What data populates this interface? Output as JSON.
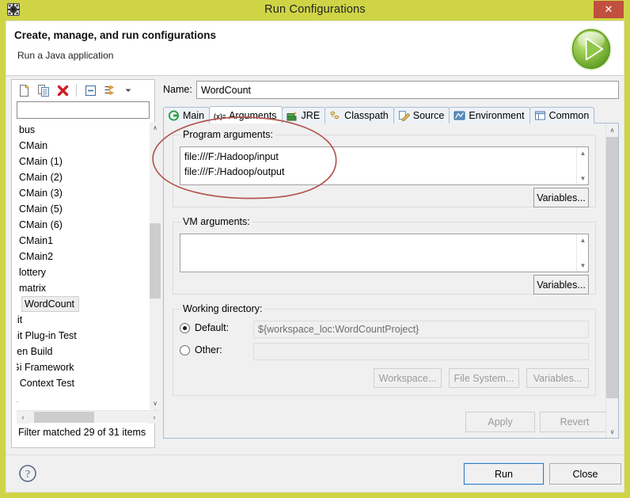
{
  "window": {
    "title": "Run Configurations",
    "app_icon": "gear-icon",
    "close_label": "✕"
  },
  "header": {
    "title": "Create, manage, and run configurations",
    "subtitle": "Run a Java application",
    "icon": "run-green-play-icon"
  },
  "tree_panel": {
    "toolbar": [
      {
        "name": "new-configuration-button",
        "tooltip": "New launch configuration"
      },
      {
        "name": "duplicate-configuration-button",
        "tooltip": "Duplicate"
      },
      {
        "name": "delete-configuration-button",
        "tooltip": "Delete"
      },
      {
        "name": "collapse-all-button",
        "tooltip": "Collapse All"
      },
      {
        "name": "filter-button",
        "tooltip": "Filter"
      },
      {
        "name": "filter-dropdown-arrow",
        "tooltip": "Filter menu"
      }
    ],
    "filter_input": {
      "value": "",
      "placeholder": ""
    },
    "items": [
      {
        "label": "bus",
        "selected": false,
        "clipped": false
      },
      {
        "label": "CMain",
        "selected": false,
        "clipped": false
      },
      {
        "label": "CMain (1)",
        "selected": false,
        "clipped": false
      },
      {
        "label": "CMain (2)",
        "selected": false,
        "clipped": false
      },
      {
        "label": "CMain (3)",
        "selected": false,
        "clipped": false
      },
      {
        "label": "CMain (5)",
        "selected": false,
        "clipped": false
      },
      {
        "label": "CMain (6)",
        "selected": false,
        "clipped": false
      },
      {
        "label": "CMain1",
        "selected": false,
        "clipped": false
      },
      {
        "label": "CMain2",
        "selected": false,
        "clipped": false
      },
      {
        "label": "lottery",
        "selected": false,
        "clipped": false
      },
      {
        "label": "matrix",
        "selected": false,
        "clipped": false
      },
      {
        "label": "WordCount",
        "selected": true,
        "clipped": false
      },
      {
        "label": "nit",
        "selected": false,
        "clipped": true
      },
      {
        "label": "nit Plug-in Test",
        "selected": false,
        "clipped": true
      },
      {
        "label": "ven Build",
        "selected": false,
        "clipped": true
      },
      {
        "label": "Gi Framework",
        "selected": false,
        "clipped": true
      },
      {
        "label": "k Context Test",
        "selected": false,
        "clipped": true
      },
      {
        "label": "L",
        "selected": false,
        "clipped": true
      }
    ],
    "status": "Filter matched 29 of 31 items",
    "scroll_up": "∧",
    "scroll_down": "∨",
    "scroll_left": "‹",
    "scroll_right": "›"
  },
  "config": {
    "name_label": "Name:",
    "name_value": "WordCount",
    "tabs": [
      {
        "label": "Main",
        "icon": "main-java-icon",
        "active": false
      },
      {
        "label": "Arguments",
        "icon": "arguments-variable-icon",
        "active": true
      },
      {
        "label": "JRE",
        "icon": "jre-books-icon",
        "active": false
      },
      {
        "label": "Classpath",
        "icon": "classpath-folders-icon",
        "active": false
      },
      {
        "label": "Source",
        "icon": "source-pencil-icon",
        "active": false
      },
      {
        "label": "Environment",
        "icon": "environment-monitor-icon",
        "active": false
      },
      {
        "label": "Common",
        "icon": "common-window-icon",
        "active": false
      }
    ]
  },
  "arguments_tab": {
    "program_arguments": {
      "label": "Program arguments:",
      "value": "file:///F:/Hadoop/input\nfile:///F:/Hadoop/output",
      "variables_button": "Variables..."
    },
    "vm_arguments": {
      "label": "VM arguments:",
      "value": "",
      "variables_button": "Variables..."
    },
    "working_directory": {
      "label": "Working directory:",
      "default_label": "Default:",
      "default_selected": true,
      "default_value": "${workspace_loc:WordCountProject}",
      "other_label": "Other:",
      "other_selected": false,
      "other_value": "",
      "workspace_button": "Workspace...",
      "file_system_button": "File System...",
      "variables_button": "Variables..."
    },
    "apply_button": "Apply",
    "revert_button": "Revert",
    "apply_enabled": false,
    "revert_enabled": false,
    "scroll_up": "∧",
    "scroll_down": "∨"
  },
  "footer": {
    "help_icon": "question-mark-icon",
    "run_button": "Run",
    "close_button": "Close"
  },
  "annotation": {
    "type": "hand-drawn-ellipse",
    "color": "#b4564f",
    "target": "program-arguments-region"
  },
  "colors": {
    "title_bar": "#cfd446",
    "close_button": "#c1503f",
    "accent_blue": "#2b7cc4",
    "panel_bg": "#f0f0f0",
    "annotation_red": "#b4564f"
  }
}
